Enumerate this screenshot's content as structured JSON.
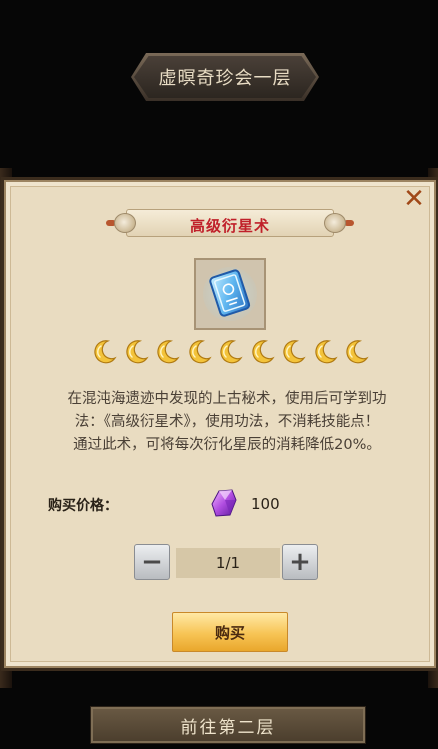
{
  "floor": {
    "title": "虚暝奇珍会一层"
  },
  "dialog": {
    "close_label": "✕",
    "item_name": "高级衍星术",
    "moon_count": 9,
    "description_lines": [
      "在混沌海遗迹中发现的上古秘术，使用后可学到功",
      "法：《高级衍星术》，使用功法，不消耗技能点！",
      "通过此术，可将每次衍化星辰的消耗降低20%。"
    ],
    "price_label": "购买价格：",
    "price_value": "100",
    "currency_icon": "purple-gem-icon",
    "quantity": "1/1",
    "minus_label": "−",
    "plus_label": "+",
    "buy_label": "购买"
  },
  "footer": {
    "next_floor_label": "前往第二层"
  },
  "colors": {
    "item_name": "#c0202a",
    "close": "#a04818",
    "panel": "#e9dcc1",
    "buy_button": "#f7c455",
    "gem": "#9b3bd6"
  }
}
